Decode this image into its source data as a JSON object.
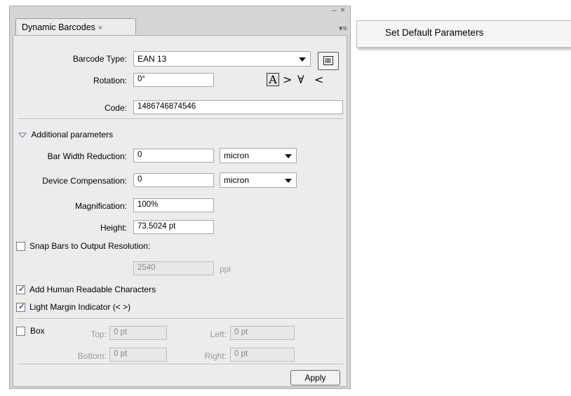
{
  "window": {
    "controls": "– ×"
  },
  "tab": {
    "title": "Dynamic Barcodes",
    "close": "×"
  },
  "panel_menu_icon": "▾≡",
  "flyout": {
    "item": "Set Default Parameters"
  },
  "barcode_type": {
    "label": "Barcode Type:",
    "value": "EAN 13"
  },
  "rotation": {
    "label": "Rotation:",
    "value": "0°"
  },
  "rotation_glyphs": {
    "r0": "A",
    "r90": ">",
    "r180": "∀",
    "r270": "<"
  },
  "code": {
    "label": "Code:",
    "value": "1486746874546"
  },
  "additional": {
    "header": "Additional parameters"
  },
  "bar_width_reduction": {
    "label": "Bar Width Reduction:",
    "value": "0",
    "unit": "micron"
  },
  "device_compensation": {
    "label": "Device Compensation:",
    "value": "0",
    "unit": "micron"
  },
  "magnification": {
    "label": "Magnification:",
    "value": "100%"
  },
  "height": {
    "label": "Height:",
    "value": "73.5024 pt"
  },
  "snap": {
    "label": "Snap Bars to Output Resolution:",
    "checked": false,
    "resolution": "2540",
    "unit": "ppi"
  },
  "human_readable": {
    "label": "Add Human Readable Characters",
    "checked": true
  },
  "light_margin": {
    "label": "Light Margin Indicator (< >)",
    "checked": true
  },
  "box": {
    "label": "Box",
    "checked": false,
    "top_label": "Top:",
    "top": "0 pt",
    "left_label": "Left:",
    "left": "0 pt",
    "bottom_label": "Bottom:",
    "bottom": "0 pt",
    "right_label": "Right:",
    "right": "0 pt"
  },
  "apply_label": "Apply",
  "check_glyph": "✓"
}
